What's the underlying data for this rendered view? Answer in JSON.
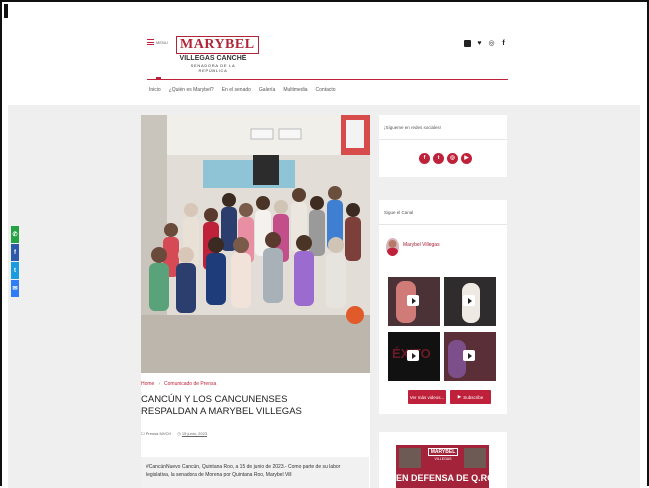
{
  "header": {
    "menu_label": "MENU",
    "logo": {
      "name": "MARYBEL",
      "subname": "VILLEGAS CANCHÉ",
      "tagline": "SENADORA DE LA REPÚBLICA"
    },
    "social_icons": [
      "instagram-icon",
      "twitter-icon",
      "instagram-outline-icon",
      "facebook-icon"
    ],
    "nav": [
      "Inicio",
      "¿Quién es Marybel?",
      "En el senado",
      "Galería",
      "Multimedia",
      "Contacto"
    ]
  },
  "share_bar": [
    {
      "icon": "whatsapp-icon",
      "glyph": "✆",
      "color": "#25a244"
    },
    {
      "icon": "facebook-icon",
      "glyph": "f",
      "color": "#2d5aa8"
    },
    {
      "icon": "twitter-icon",
      "glyph": "t",
      "color": "#1b9be0"
    },
    {
      "icon": "messenger-icon",
      "glyph": "✉",
      "color": "#2f7cf6"
    }
  ],
  "article": {
    "breadcrumb": [
      "Home",
      "›",
      "Comunicado de Prensa"
    ],
    "title": "CANCÚN Y LOS CANCUNENSES RESPALDAN A MARYBEL VILLEGAS",
    "author": "Prensa MVCH",
    "date": "15 junio, 2023",
    "excerpt": "#CancúnNuevo Cancún, Quintana Roo, a 15 de junio de 2023.- Como parte de su labor legislativa, la senadora de Morena por Quintana Roo, Marybel Vill"
  },
  "sidebar": {
    "social_title": "¡Sígueme en redes sociales!",
    "social_buttons": [
      {
        "icon": "facebook-icon",
        "glyph": "f"
      },
      {
        "icon": "twitter-icon",
        "glyph": "t"
      },
      {
        "icon": "instagram-icon",
        "glyph": "◎"
      },
      {
        "icon": "youtube-icon",
        "glyph": "▶"
      }
    ],
    "channel_title": "Sigue el Canal",
    "channel_name": "Marybel Villegas",
    "video_overlay_text": "ÉXITO",
    "more_videos": "Ver más videos...",
    "subscribe": "Subscribe",
    "banner": {
      "logo_name": "MARYBEL",
      "logo_sub": "VILLEGAS",
      "banner_text": "EN DEFENSA DE Q.ROO"
    }
  },
  "colors": {
    "brand_red": "#c0213a",
    "page_bg": "#efefef"
  }
}
